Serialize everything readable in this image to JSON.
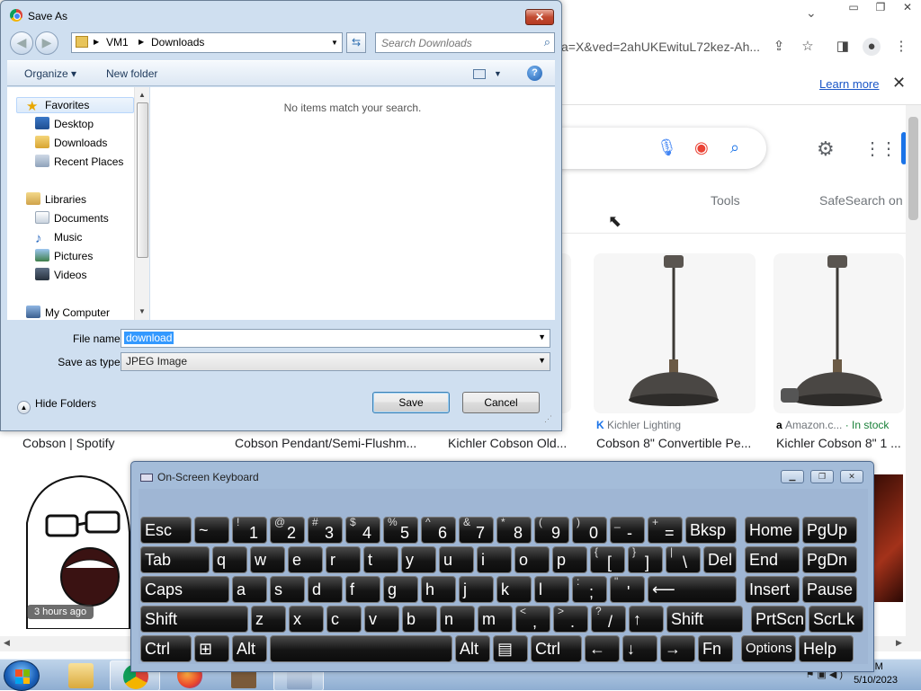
{
  "browser": {
    "url_fragment": "a=X&ved=2ahUKEwituL72kez-Ah...",
    "learn_more": "Learn more",
    "tools": "Tools",
    "safesearch": "SafeSearch on",
    "results": [
      {
        "title": "Cobson | Spotify",
        "source": ""
      },
      {
        "title": "Cobson Pendant/Semi-Flushm...",
        "source": ""
      },
      {
        "title": "Kichler Cobson Old...",
        "source": ""
      },
      {
        "title": "Cobson 8\" Convertible Pe...",
        "source": "Kichler Lighting"
      },
      {
        "title": "Kichler Cobson 8\" 1 ...",
        "source": "Amazon.c...",
        "stock": " · In stock"
      }
    ],
    "meme_badge": "3 hours ago",
    "colors": {
      "accent": "#1a73e8",
      "in_stock": "#188038"
    }
  },
  "dialog": {
    "title": "Save As",
    "path": [
      "VM1",
      "Downloads"
    ],
    "search_placeholder": "Search Downloads",
    "organize": "Organize ▾",
    "new_folder": "New folder",
    "empty_message": "No items match your search.",
    "nav": {
      "favorites": "Favorites",
      "desktop": "Desktop",
      "downloads": "Downloads",
      "recent": "Recent Places",
      "libraries": "Libraries",
      "documents": "Documents",
      "music": "Music",
      "pictures": "Pictures",
      "videos": "Videos",
      "computer": "My Computer"
    },
    "file_name_label": "File name:",
    "file_name_value": "download",
    "save_type_label": "Save as type:",
    "save_type_value": "JPEG Image",
    "hide_folders": "Hide Folders",
    "save": "Save",
    "cancel": "Cancel"
  },
  "osk": {
    "title": "On-Screen Keyboard",
    "rows": [
      [
        [
          "Esc",
          ""
        ],
        [
          "~",
          ""
        ],
        [
          "1",
          "!"
        ],
        [
          "2",
          "@"
        ],
        [
          "3",
          "#"
        ],
        [
          "4",
          "$"
        ],
        [
          "5",
          "%"
        ],
        [
          "6",
          "^"
        ],
        [
          "7",
          "&"
        ],
        [
          "8",
          "*"
        ],
        [
          "9",
          "("
        ],
        [
          "0",
          ")"
        ],
        [
          "-",
          "_"
        ],
        [
          "=",
          "+"
        ],
        [
          "Bksp",
          ""
        ],
        [
          "Home",
          ""
        ],
        [
          "PgUp",
          ""
        ]
      ],
      [
        [
          "Tab",
          ""
        ],
        [
          "q",
          ""
        ],
        [
          "w",
          ""
        ],
        [
          "e",
          ""
        ],
        [
          "r",
          ""
        ],
        [
          "t",
          ""
        ],
        [
          "y",
          ""
        ],
        [
          "u",
          ""
        ],
        [
          "i",
          ""
        ],
        [
          "o",
          ""
        ],
        [
          "p",
          ""
        ],
        [
          "[",
          "{"
        ],
        [
          "]",
          "}"
        ],
        [
          "\\",
          "|"
        ],
        [
          "Del",
          ""
        ],
        [
          "End",
          ""
        ],
        [
          "PgDn",
          ""
        ]
      ],
      [
        [
          "Caps",
          ""
        ],
        [
          "a",
          ""
        ],
        [
          "s",
          ""
        ],
        [
          "d",
          ""
        ],
        [
          "f",
          ""
        ],
        [
          "g",
          ""
        ],
        [
          "h",
          ""
        ],
        [
          "j",
          ""
        ],
        [
          "k",
          ""
        ],
        [
          "l",
          ""
        ],
        [
          ";",
          ":"
        ],
        [
          "'",
          "\""
        ],
        [
          "⟵",
          ""
        ],
        [
          "Insert",
          ""
        ],
        [
          "Pause",
          ""
        ]
      ],
      [
        [
          "Shift",
          ""
        ],
        [
          "z",
          ""
        ],
        [
          "x",
          ""
        ],
        [
          "c",
          ""
        ],
        [
          "v",
          ""
        ],
        [
          "b",
          ""
        ],
        [
          "n",
          ""
        ],
        [
          "m",
          ""
        ],
        [
          ",",
          "<"
        ],
        [
          ".",
          ">"
        ],
        [
          "/",
          "?"
        ],
        [
          "↑",
          ""
        ],
        [
          "Shift",
          ""
        ],
        [
          "PrtScn",
          ""
        ],
        [
          "ScrLk",
          ""
        ]
      ],
      [
        [
          "Ctrl",
          ""
        ],
        [
          "⊞",
          ""
        ],
        [
          "Alt",
          ""
        ],
        [
          "",
          ""
        ],
        [
          "Alt",
          ""
        ],
        [
          "▤",
          ""
        ],
        [
          "Ctrl",
          ""
        ],
        [
          "←",
          ""
        ],
        [
          "↓",
          ""
        ],
        [
          "→",
          ""
        ],
        [
          "Fn",
          ""
        ],
        [
          "Options",
          ""
        ],
        [
          "Help",
          ""
        ]
      ]
    ]
  },
  "taskbar": {
    "time": "PM",
    "date": "5/10/2023"
  }
}
